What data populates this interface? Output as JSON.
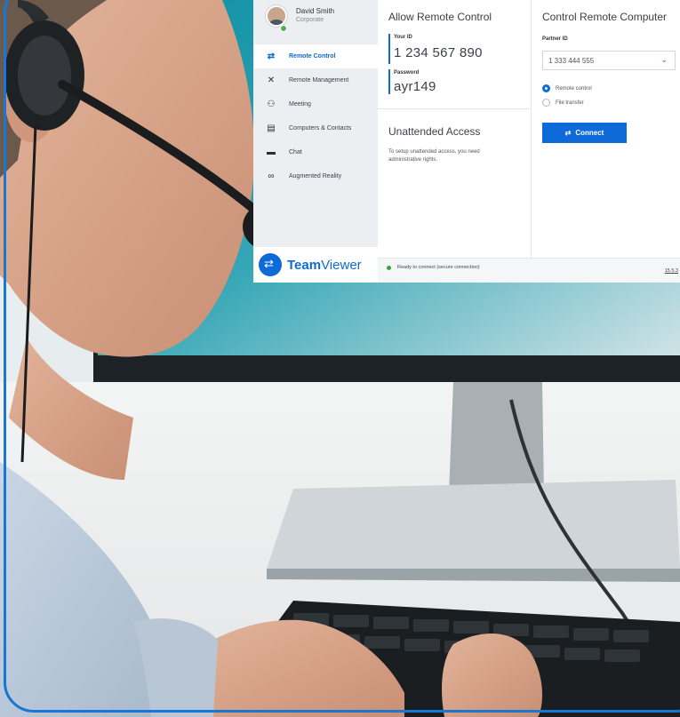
{
  "colors": {
    "accent": "#0e6ad8",
    "frame_border": "#1976d2",
    "status_green": "#43a047"
  },
  "app": {
    "profile": {
      "name": "David Smith",
      "subtitle": "Corporate"
    },
    "nav": [
      {
        "label": "Remote Control",
        "icon": "arrows-icon",
        "active": true
      },
      {
        "label": "Remote Management",
        "icon": "expand-icon",
        "active": false
      },
      {
        "label": "Meeting",
        "icon": "people-icon",
        "active": false
      },
      {
        "label": "Computers & Contacts",
        "icon": "contacts-icon",
        "active": false
      },
      {
        "label": "Chat",
        "icon": "chat-icon",
        "active": false
      },
      {
        "label": "Augmented Reality",
        "icon": "ar-glasses-icon",
        "active": false
      }
    ],
    "logo": {
      "brand_bold": "Team",
      "brand_rest": "Viewer"
    },
    "allow": {
      "title": "Allow Remote Control",
      "your_id_label": "Your ID",
      "your_id": "1 234 567 890",
      "password_label": "Password",
      "password": "ayr149"
    },
    "unattended": {
      "title": "Unattended Access",
      "note": "To setup unattended access, you need administrative rights."
    },
    "control": {
      "title": "Control Remote Computer",
      "partner_label": "Partner ID",
      "partner_value": "1 333 444 555",
      "options": [
        {
          "label": "Remote control",
          "selected": true
        },
        {
          "label": "File transfer",
          "selected": false
        }
      ],
      "connect_label": "Connect"
    },
    "status": {
      "text": "Ready to connect (secure connection)",
      "version": "15.5.3"
    }
  }
}
